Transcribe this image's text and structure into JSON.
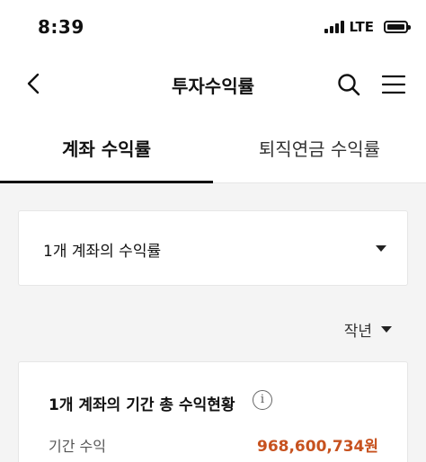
{
  "status_bar": {
    "time": "8:39",
    "network": "LTE",
    "icons": [
      "signal-icon",
      "battery-icon"
    ]
  },
  "header": {
    "title": "투자수익률",
    "icons": [
      "chevron-left-icon",
      "search-icon",
      "hamburger-menu-icon"
    ]
  },
  "tabs": [
    {
      "label": "계좌 수익률",
      "active": true
    },
    {
      "label": "퇴직연금 수익률",
      "active": false
    }
  ],
  "account_select": {
    "selected": "1개 계좌의 수익률",
    "icon": "caret-down-icon"
  },
  "period_select": {
    "selected": "작년",
    "icon": "caret-down-icon"
  },
  "summary": {
    "title": "1개 계좌의 기간 총 수익현황",
    "info_glyph": "i",
    "period_return_label": "기간 수익",
    "period_return_value": "968,600,734원",
    "accent_color": "#c7521f"
  }
}
